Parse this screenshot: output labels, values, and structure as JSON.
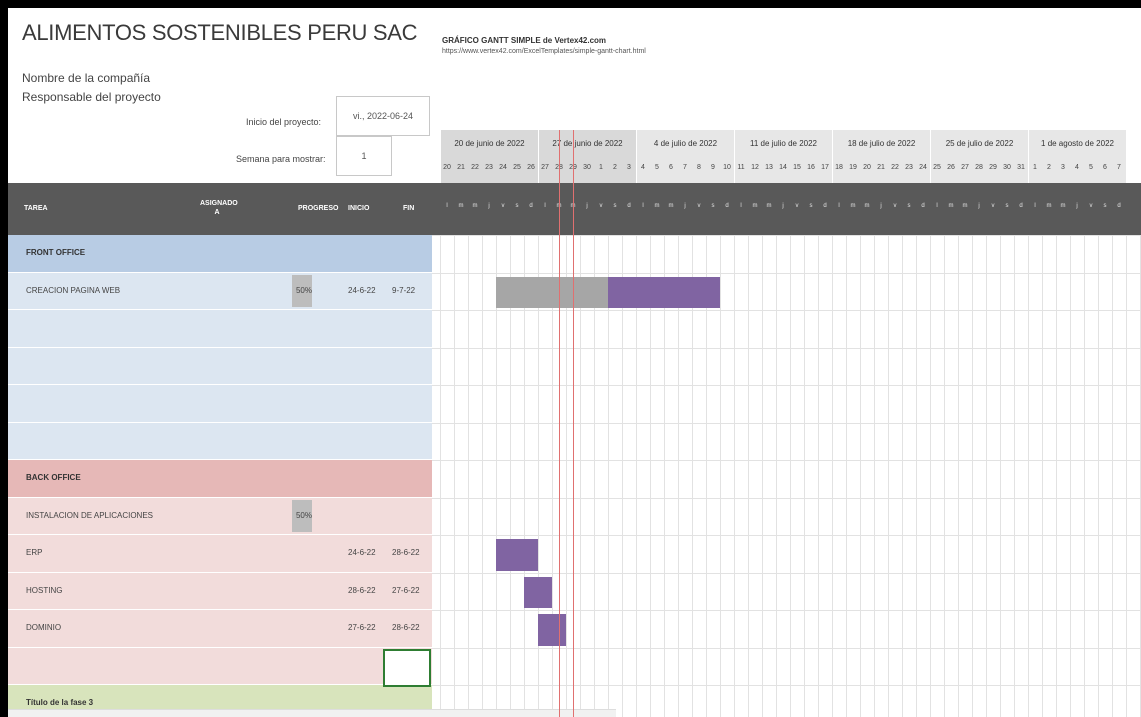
{
  "header": {
    "company": "ALIMENTOS SOSTENIBLES PERU SAC",
    "company_field": "Nombre de la compañía",
    "manager_field": "Responsable del proyecto",
    "start_label": "Inicio del proyecto:",
    "start_value": "vi., 2022-06-24",
    "week_label": "Semana para mostrar:",
    "week_value": "1",
    "gantt_title": "GRÁFICO GANTT SIMPLE de Vertex42.com",
    "gantt_url": "https://www.vertex42.com/ExcelTemplates/simple-gantt-chart.html"
  },
  "timeline": {
    "weeks": [
      "20 de junio de 2022",
      "27 de junio de 2022",
      "4 de julio de 2022",
      "11 de julio de 2022",
      "18 de julio de 2022",
      "25 de julio de 2022",
      "1 de agosto de 2022"
    ],
    "day_numbers": [
      "20",
      "21",
      "22",
      "23",
      "24",
      "25",
      "26",
      "27",
      "28",
      "29",
      "30",
      "1",
      "2",
      "3",
      "4",
      "5",
      "6",
      "7",
      "8",
      "9",
      "10",
      "11",
      "12",
      "13",
      "14",
      "15",
      "16",
      "17",
      "18",
      "19",
      "20",
      "21",
      "22",
      "23",
      "24",
      "25",
      "26",
      "27",
      "28",
      "29",
      "30",
      "31",
      "1",
      "2",
      "3",
      "4",
      "5",
      "6",
      "7"
    ],
    "day_letters": [
      "l",
      "m",
      "m",
      "j",
      "v",
      "s",
      "d"
    ]
  },
  "columns": {
    "task": "TAREA",
    "assigned": "ASIGNADO A",
    "progress": "PROGRESO",
    "start": "INICIO",
    "end": "FIN"
  },
  "rows": [
    {
      "type": "section",
      "name": "FRONT OFFICE"
    },
    {
      "type": "task",
      "name": "CREACION PAGINA WEB",
      "progress": "50%",
      "start": "24-6-22",
      "end": "9-7-22"
    },
    {
      "type": "empty"
    },
    {
      "type": "empty"
    },
    {
      "type": "empty"
    },
    {
      "type": "empty"
    },
    {
      "type": "section",
      "name": "BACK OFFICE"
    },
    {
      "type": "task",
      "name": "INSTALACION DE APLICACIONES",
      "progress": "50%",
      "start": "",
      "end": ""
    },
    {
      "type": "task",
      "name": "ERP",
      "progress": "",
      "start": "24-6-22",
      "end": "28-6-22"
    },
    {
      "type": "task",
      "name": "HOSTING",
      "progress": "",
      "start": "28-6-22",
      "end": "27-6-22"
    },
    {
      "type": "task",
      "name": "DOMINIO",
      "progress": "",
      "start": "27-6-22",
      "end": "28-6-22"
    },
    {
      "type": "empty"
    },
    {
      "type": "section",
      "name": "Título de la fase 3"
    }
  ],
  "bars": [
    {
      "row": 1,
      "done_from": "2022-06-24",
      "done_days": 8,
      "todo_days": 8
    },
    {
      "row": 8,
      "done_from": "2022-06-24",
      "done_days": 0,
      "todo_days": 3
    },
    {
      "row": 9,
      "done_from": "2022-06-26",
      "done_days": 0,
      "todo_days": 2
    },
    {
      "row": 10,
      "done_from": "2022-06-27",
      "done_days": 0,
      "todo_days": 2
    }
  ],
  "colors": {
    "header_bg": "#595959",
    "front_section": "#b8cce4",
    "front_row": "#dce6f1",
    "back_section": "#e6b8b7",
    "back_row": "#f2dcdb",
    "phase3_section": "#d8e4bc",
    "bar_done": "#a6a6a6",
    "bar_todo": "#8064a2",
    "today_line": "#e07070"
  }
}
